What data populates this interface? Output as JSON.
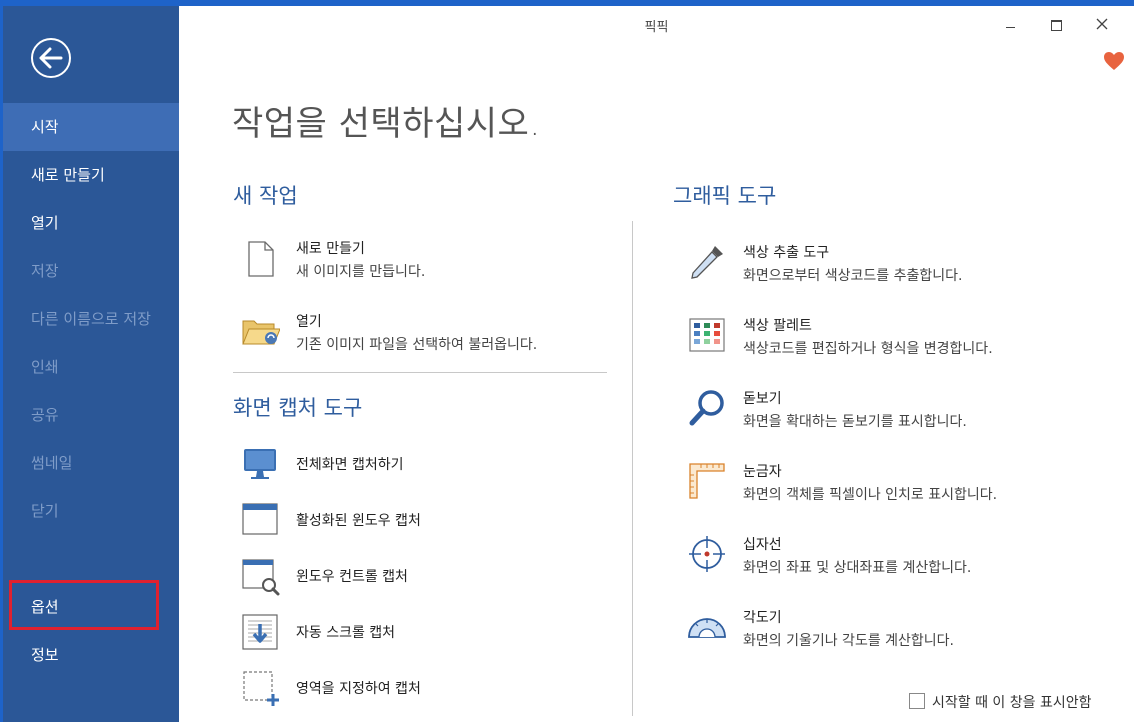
{
  "window": {
    "title": "픽픽"
  },
  "sidebar": {
    "items": [
      {
        "label": "시작",
        "state": "active"
      },
      {
        "label": "새로 만들기",
        "state": "normal"
      },
      {
        "label": "열기",
        "state": "normal"
      },
      {
        "label": "저장",
        "state": "disabled"
      },
      {
        "label": "다른 이름으로 저장",
        "state": "disabled"
      },
      {
        "label": "인쇄",
        "state": "disabled"
      },
      {
        "label": "공유",
        "state": "disabled"
      },
      {
        "label": "썸네일",
        "state": "disabled"
      },
      {
        "label": "닫기",
        "state": "disabled"
      },
      {
        "label": "옵션",
        "state": "normal"
      },
      {
        "label": "정보",
        "state": "normal"
      }
    ]
  },
  "main": {
    "heading": "작업을 선택하십시오.",
    "new_task": {
      "title": "새 작업",
      "items": [
        {
          "icon": "new-file-icon",
          "title": "새로 만들기",
          "desc": "새 이미지를 만듭니다."
        },
        {
          "icon": "open-folder-icon",
          "title": "열기",
          "desc": "기존 이미지 파일을 선택하여 불러옵니다."
        }
      ]
    },
    "capture_tools": {
      "title": "화면 캡처 도구",
      "items": [
        {
          "icon": "monitor-icon",
          "title": "전체화면 캡처하기"
        },
        {
          "icon": "window-icon",
          "title": "활성화된 윈도우 캡처"
        },
        {
          "icon": "window-control-icon",
          "title": "윈도우 컨트롤 캡처"
        },
        {
          "icon": "scroll-capture-icon",
          "title": "자동 스크롤 캡처"
        },
        {
          "icon": "region-capture-icon",
          "title": "영역을 지정하여 캡처"
        }
      ]
    },
    "graphic_tools": {
      "title": "그래픽 도구",
      "items": [
        {
          "icon": "eyedropper-icon",
          "title": "색상 추출 도구",
          "desc": "화면으로부터 색상코드를 추출합니다."
        },
        {
          "icon": "palette-icon",
          "title": "색상 팔레트",
          "desc": "색상코드를 편집하거나 형식을 변경합니다."
        },
        {
          "icon": "magnifier-icon",
          "title": "돋보기",
          "desc": "화면을 확대하는 돋보기를 표시합니다."
        },
        {
          "icon": "ruler-icon",
          "title": "눈금자",
          "desc": "화면의 객체를 픽셀이나 인치로 표시합니다."
        },
        {
          "icon": "crosshair-icon",
          "title": "십자선",
          "desc": "화면의 좌표 및 상대좌표를 계산합니다."
        },
        {
          "icon": "protractor-icon",
          "title": "각도기",
          "desc": "화면의 기울기나 각도를 계산합니다."
        }
      ]
    }
  },
  "footer": {
    "checkbox_label": "시작할 때 이 창을 표시안함",
    "checked": false
  },
  "colors": {
    "sidebar": "#2b5797",
    "active_item": "#3e6db5",
    "section_title": "#2f5d9e",
    "highlight_box": "#e0212f"
  }
}
